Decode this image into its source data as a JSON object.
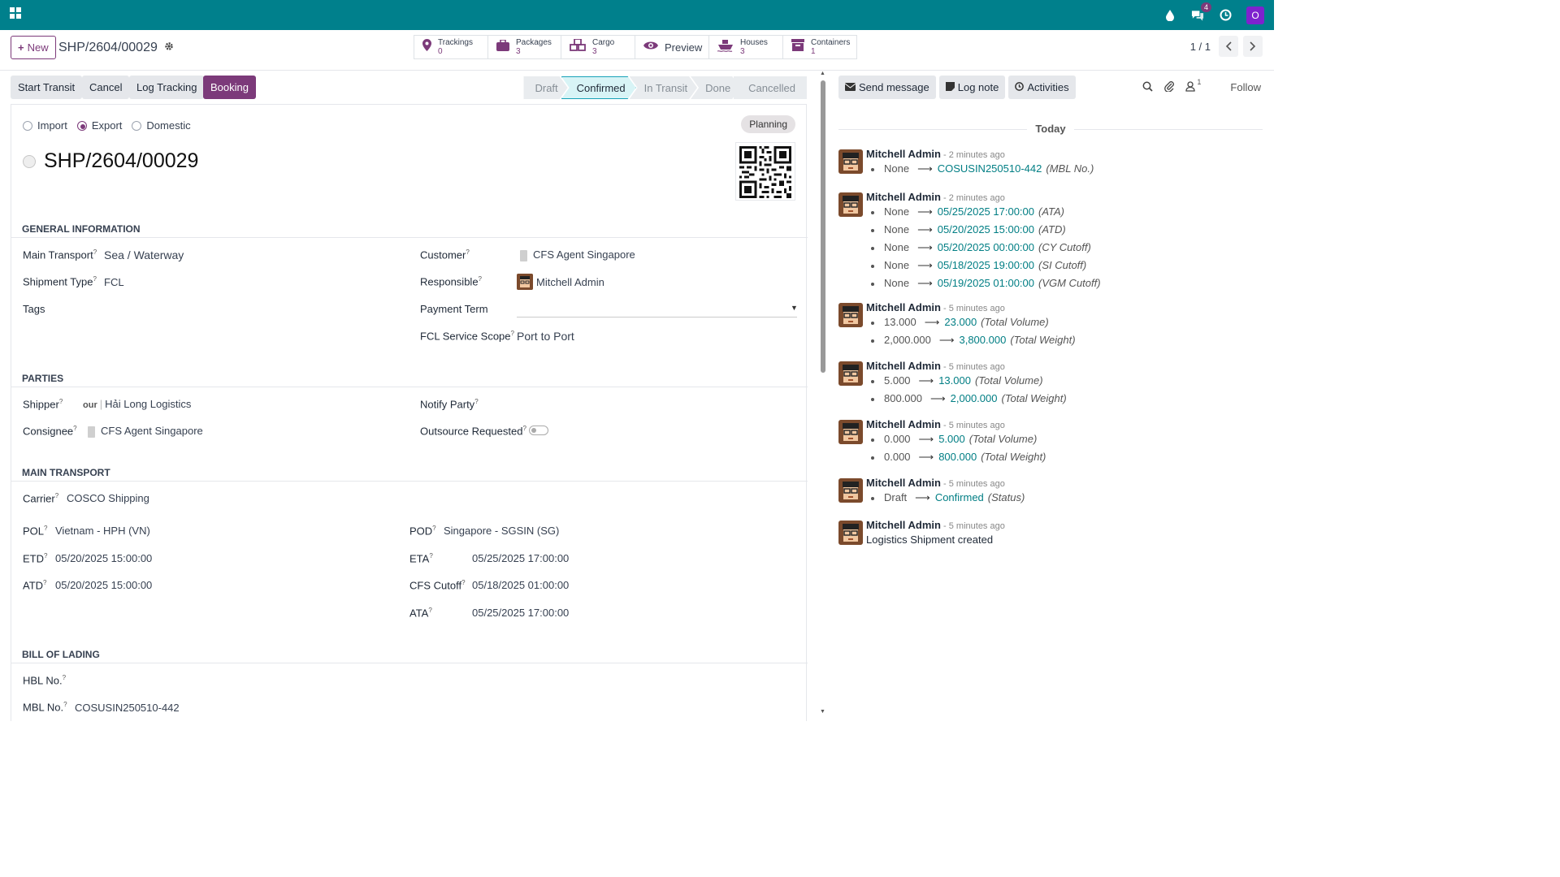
{
  "topbar": {
    "user_initial": "O",
    "chat_badge": "4"
  },
  "control": {
    "new_label": "New",
    "record_name": "SHP/2604/00029",
    "smart_buttons": [
      {
        "label": "Trackings",
        "count": "0"
      },
      {
        "label": "Packages",
        "count": "3"
      },
      {
        "label": "Cargo",
        "count": "3"
      },
      {
        "label": "Preview",
        "count": ""
      },
      {
        "label": "Houses",
        "count": "3"
      },
      {
        "label": "Containers",
        "count": "1"
      }
    ],
    "pager": "1 / 1"
  },
  "actions": {
    "start_transit": "Start Transit",
    "cancel": "Cancel",
    "log_tracking": "Log Tracking",
    "booking": "Booking"
  },
  "stages": [
    "Draft",
    "Confirmed",
    "In Transit",
    "Done",
    "Cancelled"
  ],
  "active_stage": "Confirmed",
  "form": {
    "direction_options": [
      "Import",
      "Export",
      "Domestic"
    ],
    "direction_selected": "Export",
    "planning_badge": "Planning",
    "title": "SHP/2604/00029",
    "general_header": "GENERAL INFORMATION",
    "main_transport_label": "Main Transport",
    "main_transport": "Sea / Waterway",
    "shipment_type_label": "Shipment Type",
    "shipment_type": "FCL",
    "tags_label": "Tags",
    "customer_label": "Customer",
    "customer": "CFS Agent Singapore",
    "responsible_label": "Responsible",
    "responsible": "Mitchell Admin",
    "payment_term_label": "Payment Term",
    "fcl_scope_label": "FCL Service Scope",
    "fcl_scope": "Port to Port",
    "parties_header": "PARTIES",
    "shipper_label": "Shipper",
    "shipper_prefix": "our",
    "shipper": "Hải Long Logistics",
    "consignee_label": "Consignee",
    "consignee": "CFS Agent Singapore",
    "notify_label": "Notify Party",
    "outsource_label": "Outsource Requested",
    "transport_header": "MAIN TRANSPORT",
    "carrier_label": "Carrier",
    "carrier": "COSCO Shipping",
    "pol_label": "POL",
    "pol": "Vietnam - HPH (VN)",
    "etd_label": "ETD",
    "etd": "05/20/2025 15:00:00",
    "atd_label": "ATD",
    "atd": "05/20/2025 15:00:00",
    "pod_label": "POD",
    "pod": "Singapore - SGSIN (SG)",
    "eta_label": "ETA",
    "eta": "05/25/2025 17:00:00",
    "cfs_label": "CFS Cutoff",
    "cfs": "05/18/2025 01:00:00",
    "ata_label": "ATA",
    "ata": "05/25/2025 17:00:00",
    "bol_header": "BILL OF LADING",
    "hbl_label": "HBL No.",
    "mbl_label": "MBL No.",
    "mbl": "COSUSIN250510-442"
  },
  "chatter": {
    "send_message": "Send message",
    "log_note": "Log note",
    "activities": "Activities",
    "followers_count": "1",
    "follow": "Follow",
    "today": "Today",
    "messages": [
      {
        "author": "Mitchell Admin",
        "ago": "- 2 minutes ago",
        "changes": [
          {
            "old": "None",
            "new": "COSUSIN250510-442",
            "field": "(MBL No.)"
          }
        ]
      },
      {
        "author": "Mitchell Admin",
        "ago": "- 2 minutes ago",
        "changes": [
          {
            "old": "None",
            "new": "05/25/2025 17:00:00",
            "field": "(ATA)"
          },
          {
            "old": "None",
            "new": "05/20/2025 15:00:00",
            "field": "(ATD)"
          },
          {
            "old": "None",
            "new": "05/20/2025 00:00:00",
            "field": "(CY Cutoff)"
          },
          {
            "old": "None",
            "new": "05/18/2025 19:00:00",
            "field": "(SI Cutoff)"
          },
          {
            "old": "None",
            "new": "05/19/2025 01:00:00",
            "field": "(VGM Cutoff)"
          }
        ]
      },
      {
        "author": "Mitchell Admin",
        "ago": "- 5 minutes ago",
        "changes": [
          {
            "old": "13.000",
            "new": "23.000",
            "field": "(Total Volume)"
          },
          {
            "old": "2,000.000",
            "new": "3,800.000",
            "field": "(Total Weight)"
          }
        ]
      },
      {
        "author": "Mitchell Admin",
        "ago": "- 5 minutes ago",
        "changes": [
          {
            "old": "5.000",
            "new": "13.000",
            "field": "(Total Volume)"
          },
          {
            "old": "800.000",
            "new": "2,000.000",
            "field": "(Total Weight)"
          }
        ]
      },
      {
        "author": "Mitchell Admin",
        "ago": "- 5 minutes ago",
        "changes": [
          {
            "old": "0.000",
            "new": "5.000",
            "field": "(Total Volume)"
          },
          {
            "old": "0.000",
            "new": "800.000",
            "field": "(Total Weight)"
          }
        ]
      },
      {
        "author": "Mitchell Admin",
        "ago": "- 5 minutes ago",
        "changes": [
          {
            "old": "Draft",
            "new": "Confirmed",
            "field": "(Status)"
          }
        ]
      },
      {
        "author": "Mitchell Admin",
        "ago": "- 5 minutes ago",
        "text": "Logistics Shipment created"
      }
    ]
  }
}
